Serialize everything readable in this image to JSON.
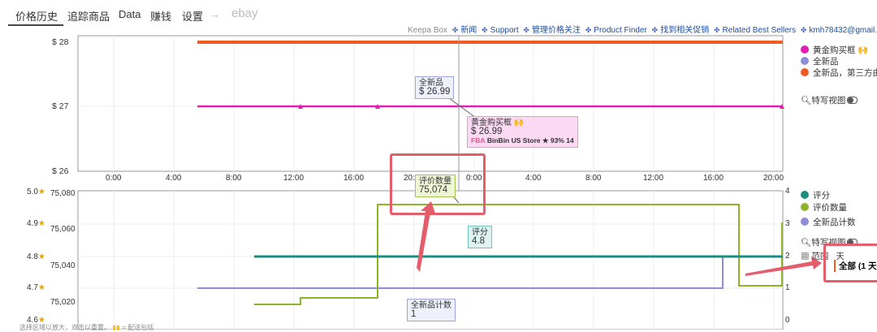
{
  "tabs": [
    {
      "label": "价格历史",
      "active": true
    },
    {
      "label": "追踪商品"
    },
    {
      "label": "Data"
    },
    {
      "label": "赚钱"
    },
    {
      "label": "设置"
    },
    {
      "label": "→"
    },
    {
      "label": "ebay"
    }
  ],
  "top_links": {
    "brand": "Keepa Box",
    "items": [
      "新闻",
      "Support",
      "管理价格关注",
      "Product Finder",
      "找到相关促销",
      "Related Best Sellers",
      "kmh78432@gmail."
    ]
  },
  "price_chart": {
    "y_labels": [
      "$ 28",
      "$ 27",
      "$ 26"
    ],
    "x_labels": [
      "0:00",
      "4:00",
      "8:00",
      "12:00",
      "16:00",
      "20:00",
      "0:00",
      "4:00",
      "8:00",
      "12:00",
      "16:00",
      "20:00"
    ],
    "legend": [
      {
        "label": "黄金购买框 🙌",
        "color": "#e21fb4"
      },
      {
        "label": "全新品",
        "color": "#8e8ed8"
      },
      {
        "label": "全新品，第三方由",
        "color": "#f15b22"
      }
    ],
    "closeup_label": "特写视图",
    "tooltip_new": {
      "title": "全新品",
      "value": "$ 26.99"
    },
    "tooltip_buybox": {
      "title": "黄金购买框 🙌",
      "value": "$ 26.99",
      "fba": "FBA",
      "seller": "BinBin US Store ★ 93%  14"
    }
  },
  "review_chart": {
    "rating_labels": [
      "5.0",
      "4.9",
      "4.8",
      "4.7",
      "4.6"
    ],
    "count_labels": [
      "75,080",
      "75,060",
      "75,040",
      "75,020"
    ],
    "right_labels": [
      "4",
      "3",
      "2",
      "1",
      "0"
    ],
    "legend": [
      {
        "label": "评分",
        "color": "#1a8f80"
      },
      {
        "label": "评价数量",
        "color": "#8db52a"
      },
      {
        "label": "全新品计数",
        "color": "#8e8ed8"
      }
    ],
    "closeup_label": "特写视图",
    "range_label": "范围",
    "range_unit": "天",
    "range_selected": "全部 (1 天",
    "tooltip_reviews": {
      "title": "评价数量",
      "value": "75,074"
    },
    "tooltip_rating": {
      "title": "评分",
      "value": "4.8"
    },
    "tooltip_newcount": {
      "title": "全新品计数",
      "value": "1"
    },
    "footer_note": "选择区域以放大，双击以重置。 🙌 = 配送包括"
  },
  "chart_data": [
    {
      "type": "line",
      "title": "",
      "ylim": [
        26,
        28
      ],
      "x": [
        "0:00",
        "4:00",
        "8:00",
        "12:00",
        "16:00",
        "20:00",
        "0:00",
        "4:00",
        "8:00",
        "12:00",
        "16:00",
        "20:00"
      ],
      "series": [
        {
          "name": "黄金购买框",
          "values": [
            26.99,
            26.99
          ]
        },
        {
          "name": "全新品",
          "values": [
            26.99,
            26.99
          ]
        },
        {
          "name": "全新品，第三方由",
          "values": [
            27.99,
            27.99
          ]
        }
      ]
    },
    {
      "type": "line",
      "title": "",
      "series": [
        {
          "name": "评分",
          "values": [
            4.8,
            4.8
          ]
        },
        {
          "name": "评价数量",
          "values": [
            75016,
            75018,
            75074,
            75074,
            75028
          ]
        },
        {
          "name": "全新品计数",
          "values": [
            1,
            1,
            2,
            2
          ]
        }
      ]
    }
  ]
}
